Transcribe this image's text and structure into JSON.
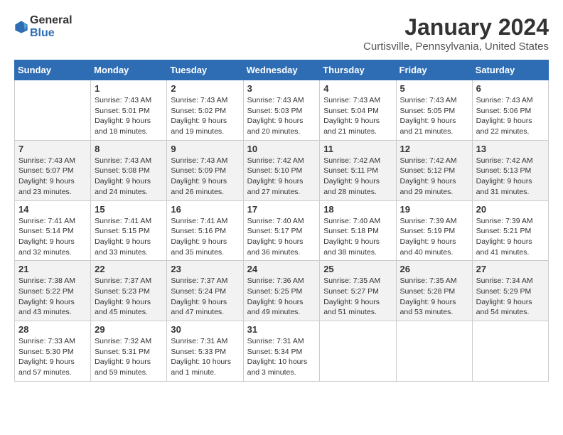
{
  "header": {
    "logo_line1": "General",
    "logo_line2": "Blue",
    "month_title": "January 2024",
    "location": "Curtisville, Pennsylvania, United States"
  },
  "weekdays": [
    "Sunday",
    "Monday",
    "Tuesday",
    "Wednesday",
    "Thursday",
    "Friday",
    "Saturday"
  ],
  "weeks": [
    [
      {
        "day": "",
        "sunrise": "",
        "sunset": "",
        "daylight": ""
      },
      {
        "day": "1",
        "sunrise": "Sunrise: 7:43 AM",
        "sunset": "Sunset: 5:01 PM",
        "daylight": "Daylight: 9 hours and 18 minutes."
      },
      {
        "day": "2",
        "sunrise": "Sunrise: 7:43 AM",
        "sunset": "Sunset: 5:02 PM",
        "daylight": "Daylight: 9 hours and 19 minutes."
      },
      {
        "day": "3",
        "sunrise": "Sunrise: 7:43 AM",
        "sunset": "Sunset: 5:03 PM",
        "daylight": "Daylight: 9 hours and 20 minutes."
      },
      {
        "day": "4",
        "sunrise": "Sunrise: 7:43 AM",
        "sunset": "Sunset: 5:04 PM",
        "daylight": "Daylight: 9 hours and 21 minutes."
      },
      {
        "day": "5",
        "sunrise": "Sunrise: 7:43 AM",
        "sunset": "Sunset: 5:05 PM",
        "daylight": "Daylight: 9 hours and 21 minutes."
      },
      {
        "day": "6",
        "sunrise": "Sunrise: 7:43 AM",
        "sunset": "Sunset: 5:06 PM",
        "daylight": "Daylight: 9 hours and 22 minutes."
      }
    ],
    [
      {
        "day": "7",
        "sunrise": "Sunrise: 7:43 AM",
        "sunset": "Sunset: 5:07 PM",
        "daylight": "Daylight: 9 hours and 23 minutes."
      },
      {
        "day": "8",
        "sunrise": "Sunrise: 7:43 AM",
        "sunset": "Sunset: 5:08 PM",
        "daylight": "Daylight: 9 hours and 24 minutes."
      },
      {
        "day": "9",
        "sunrise": "Sunrise: 7:43 AM",
        "sunset": "Sunset: 5:09 PM",
        "daylight": "Daylight: 9 hours and 26 minutes."
      },
      {
        "day": "10",
        "sunrise": "Sunrise: 7:42 AM",
        "sunset": "Sunset: 5:10 PM",
        "daylight": "Daylight: 9 hours and 27 minutes."
      },
      {
        "day": "11",
        "sunrise": "Sunrise: 7:42 AM",
        "sunset": "Sunset: 5:11 PM",
        "daylight": "Daylight: 9 hours and 28 minutes."
      },
      {
        "day": "12",
        "sunrise": "Sunrise: 7:42 AM",
        "sunset": "Sunset: 5:12 PM",
        "daylight": "Daylight: 9 hours and 29 minutes."
      },
      {
        "day": "13",
        "sunrise": "Sunrise: 7:42 AM",
        "sunset": "Sunset: 5:13 PM",
        "daylight": "Daylight: 9 hours and 31 minutes."
      }
    ],
    [
      {
        "day": "14",
        "sunrise": "Sunrise: 7:41 AM",
        "sunset": "Sunset: 5:14 PM",
        "daylight": "Daylight: 9 hours and 32 minutes."
      },
      {
        "day": "15",
        "sunrise": "Sunrise: 7:41 AM",
        "sunset": "Sunset: 5:15 PM",
        "daylight": "Daylight: 9 hours and 33 minutes."
      },
      {
        "day": "16",
        "sunrise": "Sunrise: 7:41 AM",
        "sunset": "Sunset: 5:16 PM",
        "daylight": "Daylight: 9 hours and 35 minutes."
      },
      {
        "day": "17",
        "sunrise": "Sunrise: 7:40 AM",
        "sunset": "Sunset: 5:17 PM",
        "daylight": "Daylight: 9 hours and 36 minutes."
      },
      {
        "day": "18",
        "sunrise": "Sunrise: 7:40 AM",
        "sunset": "Sunset: 5:18 PM",
        "daylight": "Daylight: 9 hours and 38 minutes."
      },
      {
        "day": "19",
        "sunrise": "Sunrise: 7:39 AM",
        "sunset": "Sunset: 5:19 PM",
        "daylight": "Daylight: 9 hours and 40 minutes."
      },
      {
        "day": "20",
        "sunrise": "Sunrise: 7:39 AM",
        "sunset": "Sunset: 5:21 PM",
        "daylight": "Daylight: 9 hours and 41 minutes."
      }
    ],
    [
      {
        "day": "21",
        "sunrise": "Sunrise: 7:38 AM",
        "sunset": "Sunset: 5:22 PM",
        "daylight": "Daylight: 9 hours and 43 minutes."
      },
      {
        "day": "22",
        "sunrise": "Sunrise: 7:37 AM",
        "sunset": "Sunset: 5:23 PM",
        "daylight": "Daylight: 9 hours and 45 minutes."
      },
      {
        "day": "23",
        "sunrise": "Sunrise: 7:37 AM",
        "sunset": "Sunset: 5:24 PM",
        "daylight": "Daylight: 9 hours and 47 minutes."
      },
      {
        "day": "24",
        "sunrise": "Sunrise: 7:36 AM",
        "sunset": "Sunset: 5:25 PM",
        "daylight": "Daylight: 9 hours and 49 minutes."
      },
      {
        "day": "25",
        "sunrise": "Sunrise: 7:35 AM",
        "sunset": "Sunset: 5:27 PM",
        "daylight": "Daylight: 9 hours and 51 minutes."
      },
      {
        "day": "26",
        "sunrise": "Sunrise: 7:35 AM",
        "sunset": "Sunset: 5:28 PM",
        "daylight": "Daylight: 9 hours and 53 minutes."
      },
      {
        "day": "27",
        "sunrise": "Sunrise: 7:34 AM",
        "sunset": "Sunset: 5:29 PM",
        "daylight": "Daylight: 9 hours and 54 minutes."
      }
    ],
    [
      {
        "day": "28",
        "sunrise": "Sunrise: 7:33 AM",
        "sunset": "Sunset: 5:30 PM",
        "daylight": "Daylight: 9 hours and 57 minutes."
      },
      {
        "day": "29",
        "sunrise": "Sunrise: 7:32 AM",
        "sunset": "Sunset: 5:31 PM",
        "daylight": "Daylight: 9 hours and 59 minutes."
      },
      {
        "day": "30",
        "sunrise": "Sunrise: 7:31 AM",
        "sunset": "Sunset: 5:33 PM",
        "daylight": "Daylight: 10 hours and 1 minute."
      },
      {
        "day": "31",
        "sunrise": "Sunrise: 7:31 AM",
        "sunset": "Sunset: 5:34 PM",
        "daylight": "Daylight: 10 hours and 3 minutes."
      },
      {
        "day": "",
        "sunrise": "",
        "sunset": "",
        "daylight": ""
      },
      {
        "day": "",
        "sunrise": "",
        "sunset": "",
        "daylight": ""
      },
      {
        "day": "",
        "sunrise": "",
        "sunset": "",
        "daylight": ""
      }
    ]
  ]
}
